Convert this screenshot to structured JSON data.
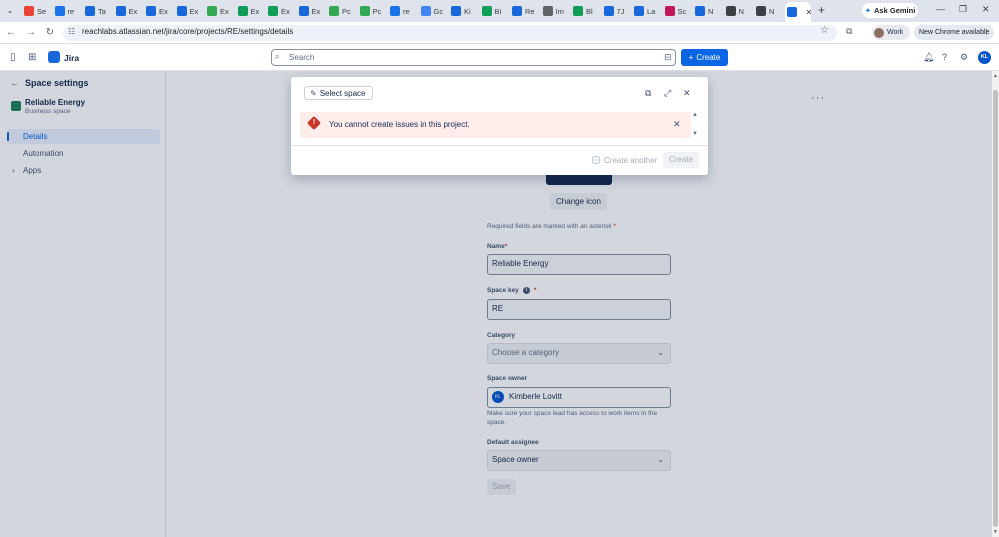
{
  "browser": {
    "tabs": [
      {
        "label": "Se",
        "color": "#ea4335"
      },
      {
        "label": "re",
        "color": "#1a73e8"
      },
      {
        "label": "Ta",
        "color": "#1868db"
      },
      {
        "label": "Ex",
        "color": "#1868db"
      },
      {
        "label": "Ex",
        "color": "#1868db"
      },
      {
        "label": "Ex",
        "color": "#1868db"
      },
      {
        "label": "Ex",
        "color": "#34a853"
      },
      {
        "label": "Ex",
        "color": "#0f9d58"
      },
      {
        "label": "Ex",
        "color": "#0f9d58"
      },
      {
        "label": "Ex",
        "color": "#1868db"
      },
      {
        "label": "Pc",
        "color": "#34a853"
      },
      {
        "label": "Pc",
        "color": "#34a853"
      },
      {
        "label": "re",
        "color": "#1a73e8"
      },
      {
        "label": "Gc",
        "color": "#4285f4"
      },
      {
        "label": "Ki",
        "color": "#1868db"
      },
      {
        "label": "Bi",
        "color": "#0f9d58"
      },
      {
        "label": "Re",
        "color": "#1868db"
      },
      {
        "label": "Im",
        "color": "#5f6368"
      },
      {
        "label": "Bl",
        "color": "#0f9d58"
      },
      {
        "label": "7J",
        "color": "#1868db"
      },
      {
        "label": "La",
        "color": "#1868db"
      },
      {
        "label": "Sc",
        "color": "#c2185b"
      },
      {
        "label": "N",
        "color": "#1868db"
      },
      {
        "label": "N",
        "color": "#3c4043"
      },
      {
        "label": "N",
        "color": "#3c4043"
      }
    ],
    "active_tab_color": "#1868db",
    "ask_gemini": "Ask Gemini",
    "url": "reachlabs.atlassian.net/jira/core/projects/RE/settings/details",
    "profile_label": "Work",
    "chrome_update": "New Chrome available"
  },
  "jira": {
    "product_name": "Jira",
    "search_placeholder": "Search",
    "create_label": "Create",
    "user_initials": "KL"
  },
  "sidebar": {
    "title": "Space settings",
    "space_name": "Reliable Energy",
    "space_type": "Business space",
    "items": [
      {
        "label": "Details"
      },
      {
        "label": "Automation"
      },
      {
        "label": "Apps"
      }
    ]
  },
  "form": {
    "change_icon": "Change icon",
    "required_note": "Required fields are marked with an asterisk",
    "asterisk": "*",
    "name_label": "Name",
    "name_value": "Reliable Energy",
    "key_label": "Space key",
    "key_value": "RE",
    "category_label": "Category",
    "category_placeholder": "Choose a category",
    "owner_label": "Space owner",
    "owner_initials": "KL",
    "owner_value": "Kimberle Lovitt",
    "owner_helper": "Make sure your space lead has access to work items in the space.",
    "assignee_label": "Default assignee",
    "assignee_value": "Space owner",
    "save_label": "Save"
  },
  "modal": {
    "select_space": "Select space",
    "error_message": "You cannot create issues in this project.",
    "create_another": "Create another",
    "create_label": "Create"
  }
}
